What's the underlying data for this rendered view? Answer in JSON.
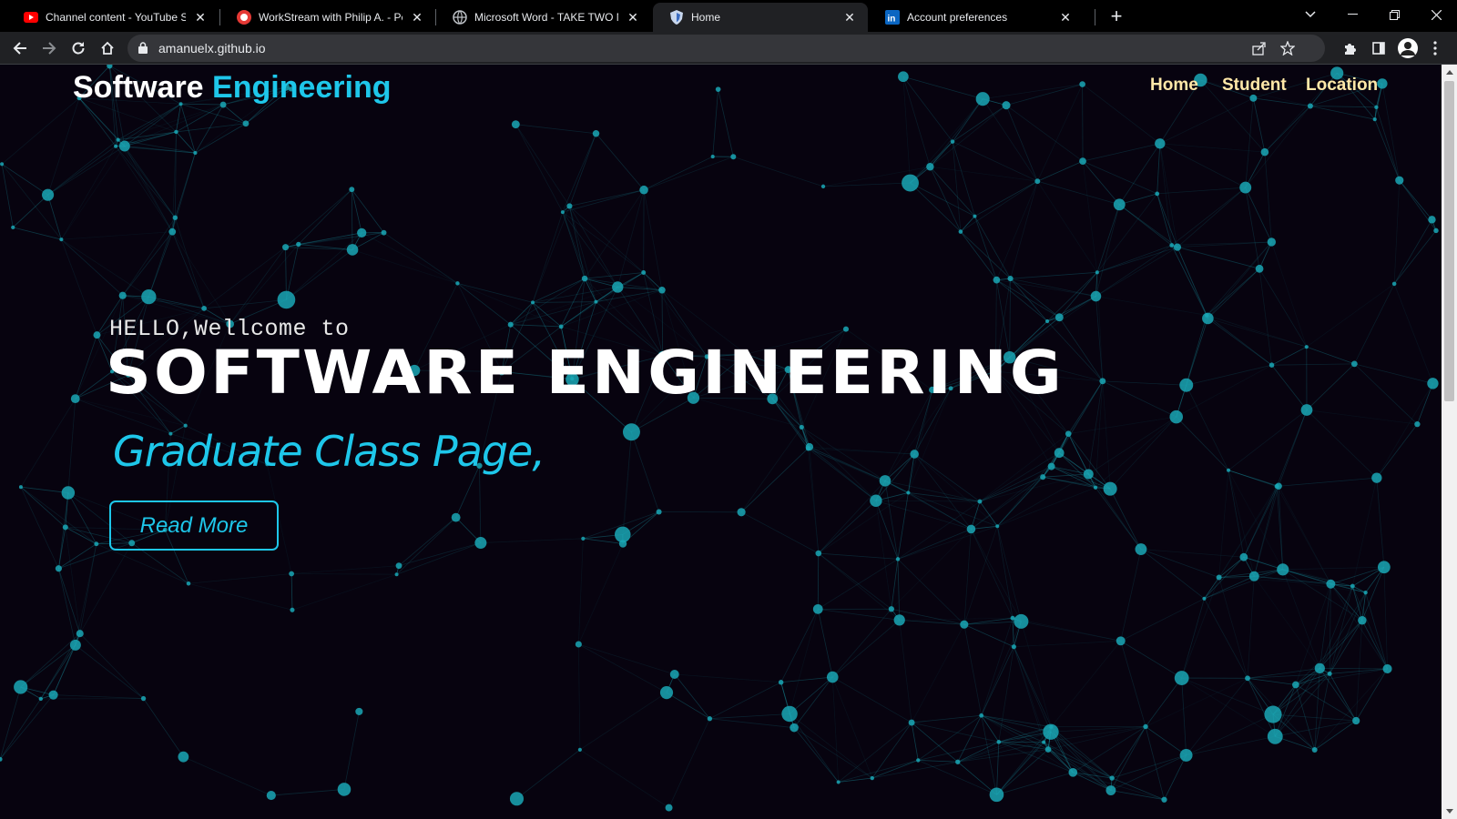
{
  "browser": {
    "tabs": [
      {
        "title": "Channel content - YouTube Studio",
        "icon": "youtube-icon"
      },
      {
        "title": "WorkStream with Philip A. - People",
        "icon": "workstream-icon"
      },
      {
        "title": "Microsoft Word - TAKE TWO MAN",
        "icon": "globe-icon"
      },
      {
        "title": "Home",
        "icon": "shield-icon"
      },
      {
        "title": "Account preferences",
        "icon": "linkedin-icon"
      }
    ],
    "active_tab": 3,
    "url": "amanuelx.github.io"
  },
  "site": {
    "brand_main": "Software",
    "brand_accent": "Engineering",
    "nav": [
      "Home",
      "Student",
      "Location"
    ],
    "hello": "HELLO,Wellcome to",
    "headline": "SOFTWARE ENGINEERING",
    "subline": "Graduate Class Page,",
    "read_more": "Read More"
  },
  "colors": {
    "background": "#07030f",
    "accent": "#1ec7ea",
    "nav_text": "#ffe8a8",
    "particle": "#1aa7b5"
  }
}
